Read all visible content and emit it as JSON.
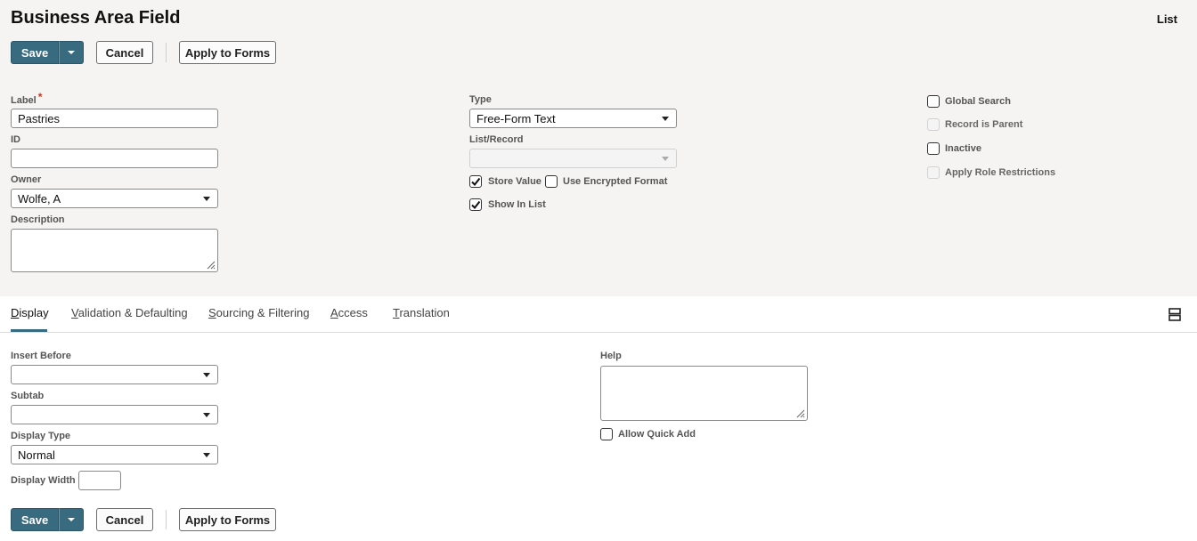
{
  "header": {
    "title": "Business Area Field",
    "list_link": "List"
  },
  "toolbar": {
    "save_label": "Save",
    "cancel_label": "Cancel",
    "apply_label": "Apply to Forms"
  },
  "form": {
    "label": {
      "label": "Label",
      "required_mark": "*",
      "value": "Pastries"
    },
    "id": {
      "label": "ID",
      "value": ""
    },
    "owner": {
      "label": "Owner",
      "value": "Wolfe, A"
    },
    "description": {
      "label": "Description",
      "value": ""
    },
    "type": {
      "label": "Type",
      "value": "Free-Form Text"
    },
    "list_record": {
      "label": "List/Record",
      "value": ""
    },
    "store_value": {
      "label": "Store Value",
      "checked": true
    },
    "encrypted": {
      "label": "Use Encrypted Format",
      "checked": false
    },
    "show_in_list": {
      "label": "Show In List",
      "checked": true
    },
    "global_search": {
      "label": "Global Search",
      "checked": false
    },
    "record_is_parent": {
      "label": "Record is Parent",
      "checked": false,
      "disabled": true
    },
    "inactive": {
      "label": "Inactive",
      "checked": false
    },
    "role_restrictions": {
      "label": "Apply Role Restrictions",
      "checked": false,
      "disabled": true
    }
  },
  "tabs": [
    {
      "label": "Display",
      "accel": "D",
      "rest": "isplay",
      "active": true
    },
    {
      "label": "Validation & Defaulting",
      "accel": "V",
      "rest": "alidation & Defaulting"
    },
    {
      "label": "Sourcing & Filtering",
      "accel": "S",
      "rest": "ourcing & Filtering"
    },
    {
      "label": "Access",
      "accel": "A",
      "rest": "ccess"
    },
    {
      "label": "Translation",
      "accel": "T",
      "rest": "ranslation"
    }
  ],
  "display": {
    "insert_before": {
      "label": "Insert Before",
      "value": ""
    },
    "subtab": {
      "label": "Subtab",
      "value": ""
    },
    "display_type": {
      "label": "Display Type",
      "value": "Normal"
    },
    "display_width": {
      "label": "Display Width",
      "value": ""
    },
    "help": {
      "label": "Help",
      "value": ""
    },
    "allow_quick_add": {
      "label": "Allow Quick Add",
      "checked": false
    }
  },
  "colors": {
    "primary": "#386a80",
    "header_bg": "#f5f4f2",
    "required": "#c0391b"
  },
  "icons": {
    "dropdown": "chevron-down-icon",
    "layout": "layout-toggle-icon",
    "checkmark": "checkmark-icon",
    "resize": "resize-grip-icon"
  }
}
